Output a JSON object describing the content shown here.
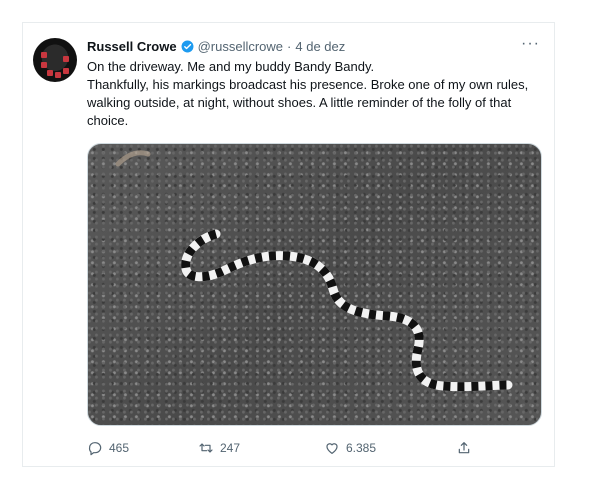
{
  "tweet": {
    "author_name": "Russell Crowe",
    "handle": "@russellcrowe",
    "separator": "·",
    "date": "4 de dez",
    "more_label": "···",
    "text_lines": [
      "On the driveway. Me and my buddy Bandy Bandy.",
      "Thankfully, his markings broadcast his presence. Broke one of my own rules, walking outside, at night, without shoes. A little reminder of the folly of that choice."
    ]
  },
  "actions": {
    "replies": "465",
    "retweets": "247",
    "likes": "6.385"
  },
  "icons": {
    "verified": "verified-badge-icon",
    "reply": "reply-icon",
    "retweet": "retweet-icon",
    "like": "heart-icon",
    "share": "share-icon",
    "more": "more-options-icon"
  },
  "colors": {
    "accent": "#1d9bf0",
    "muted_text": "#536471",
    "primary_text": "#0f1419"
  }
}
